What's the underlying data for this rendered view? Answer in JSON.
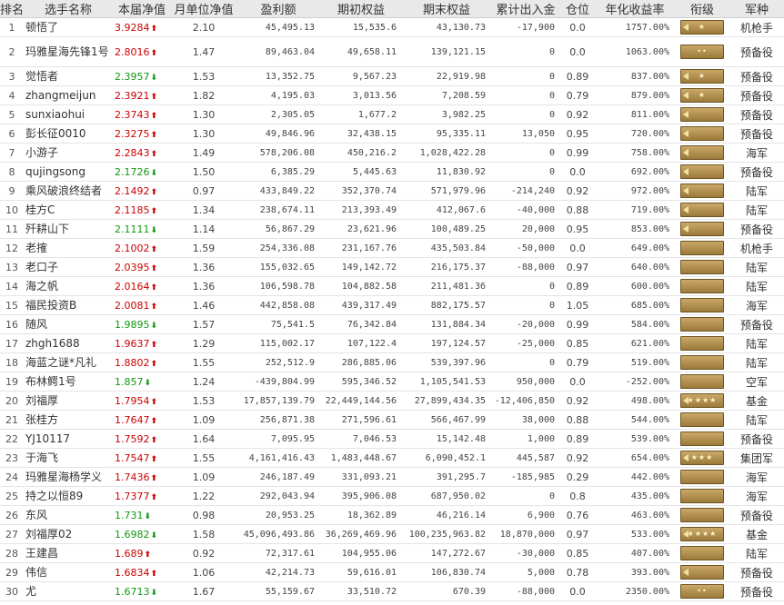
{
  "headers": [
    "排名",
    "选手名称",
    "本届净值",
    "月单位净值",
    "盈利额",
    "期初权益",
    "期末权益",
    "累计出入金",
    "仓位",
    "年化收益率",
    "衔级",
    "军种"
  ],
  "rows": [
    {
      "rank": "1",
      "name": "顿悟了",
      "nav": "3.9284",
      "dir": "up",
      "monthly": "2.10",
      "profit": "45,495.13",
      "start": "15,535.6",
      "end": "43,130.73",
      "flow": "-17,900",
      "pos": "0.0",
      "annual": "1757.00%",
      "stars": "★",
      "ornate": true,
      "corps": "机枪手",
      "tall": false
    },
    {
      "rank": "2",
      "name": "玛雅星海先锋1号",
      "nav": "2.8016",
      "dir": "up",
      "monthly": "1.47",
      "profit": "89,463.04",
      "start": "49,658.11",
      "end": "139,121.15",
      "flow": "0",
      "pos": "0.0",
      "annual": "1063.00%",
      "stars": "••",
      "ornate": false,
      "corps": "预备役",
      "tall": true
    },
    {
      "rank": "3",
      "name": "觉悟者",
      "nav": "2.3957",
      "dir": "down",
      "monthly": "1.53",
      "profit": "13,352.75",
      "start": "9,567.23",
      "end": "22,919.98",
      "flow": "0",
      "pos": "0.89",
      "annual": "837.00%",
      "stars": "★",
      "ornate": true,
      "corps": "预备役",
      "tall": false
    },
    {
      "rank": "4",
      "name": "zhangmeijun",
      "nav": "2.3921",
      "dir": "up",
      "monthly": "1.82",
      "profit": "4,195.03",
      "start": "3,013.56",
      "end": "7,208.59",
      "flow": "0",
      "pos": "0.79",
      "annual": "879.00%",
      "stars": "★",
      "ornate": true,
      "corps": "预备役",
      "tall": false
    },
    {
      "rank": "5",
      "name": "sunxiaohui",
      "nav": "2.3743",
      "dir": "up",
      "monthly": "1.30",
      "profit": "2,305.05",
      "start": "1,677.2",
      "end": "3,982.25",
      "flow": "0",
      "pos": "0.92",
      "annual": "811.00%",
      "stars": "",
      "ornate": true,
      "corps": "预备役",
      "tall": false
    },
    {
      "rank": "6",
      "name": "彭长征0010",
      "nav": "2.3275",
      "dir": "up",
      "monthly": "1.30",
      "profit": "49,846.96",
      "start": "32,438.15",
      "end": "95,335.11",
      "flow": "13,050",
      "pos": "0.95",
      "annual": "720.00%",
      "stars": "",
      "ornate": true,
      "corps": "预备役",
      "tall": false
    },
    {
      "rank": "7",
      "name": "小游子",
      "nav": "2.2843",
      "dir": "up",
      "monthly": "1.49",
      "profit": "578,206.08",
      "start": "450,216.2",
      "end": "1,028,422.28",
      "flow": "0",
      "pos": "0.99",
      "annual": "758.00%",
      "stars": "",
      "ornate": true,
      "corps": "海军",
      "tall": false
    },
    {
      "rank": "8",
      "name": "qujingsong",
      "nav": "2.1726",
      "dir": "down",
      "monthly": "1.50",
      "profit": "6,385.29",
      "start": "5,445.63",
      "end": "11,830.92",
      "flow": "0",
      "pos": "0.0",
      "annual": "692.00%",
      "stars": "",
      "ornate": true,
      "corps": "预备役",
      "tall": false
    },
    {
      "rank": "9",
      "name": "乘风破浪终结者",
      "nav": "2.1492",
      "dir": "up",
      "monthly": "0.97",
      "profit": "433,849.22",
      "start": "352,370.74",
      "end": "571,979.96",
      "flow": "-214,240",
      "pos": "0.92",
      "annual": "972.00%",
      "stars": "",
      "ornate": true,
      "corps": "陆军",
      "tall": false
    },
    {
      "rank": "10",
      "name": "桂方C",
      "nav": "2.1185",
      "dir": "up",
      "monthly": "1.34",
      "profit": "238,674.11",
      "start": "213,393.49",
      "end": "412,067.6",
      "flow": "-40,000",
      "pos": "0.88",
      "annual": "719.00%",
      "stars": "",
      "ornate": true,
      "corps": "陆军",
      "tall": false
    },
    {
      "rank": "11",
      "name": "歼耕山下",
      "nav": "2.1111",
      "dir": "down",
      "monthly": "1.14",
      "profit": "56,867.29",
      "start": "23,621.96",
      "end": "100,489.25",
      "flow": "20,000",
      "pos": "0.95",
      "annual": "853.00%",
      "stars": "",
      "ornate": true,
      "corps": "预备役",
      "tall": false
    },
    {
      "rank": "12",
      "name": "老搉",
      "nav": "2.1002",
      "dir": "up",
      "monthly": "1.59",
      "profit": "254,336.08",
      "start": "231,167.76",
      "end": "435,503.84",
      "flow": "-50,000",
      "pos": "0.0",
      "annual": "649.00%",
      "stars": "",
      "ornate": false,
      "corps": "机枪手",
      "tall": false
    },
    {
      "rank": "13",
      "name": "老口子",
      "nav": "2.0395",
      "dir": "up",
      "monthly": "1.36",
      "profit": "155,032.65",
      "start": "149,142.72",
      "end": "216,175.37",
      "flow": "-88,000",
      "pos": "0.97",
      "annual": "640.00%",
      "stars": "",
      "ornate": false,
      "corps": "陆军",
      "tall": false
    },
    {
      "rank": "14",
      "name": "海之帆",
      "nav": "2.0164",
      "dir": "up",
      "monthly": "1.36",
      "profit": "106,598.78",
      "start": "104,882.58",
      "end": "211,481.36",
      "flow": "0",
      "pos": "0.89",
      "annual": "600.00%",
      "stars": "",
      "ornate": false,
      "corps": "陆军",
      "tall": false
    },
    {
      "rank": "15",
      "name": "福民投资B",
      "nav": "2.0081",
      "dir": "up",
      "monthly": "1.46",
      "profit": "442,858.08",
      "start": "439,317.49",
      "end": "882,175.57",
      "flow": "0",
      "pos": "1.05",
      "annual": "685.00%",
      "stars": "",
      "ornate": false,
      "corps": "海军",
      "tall": false
    },
    {
      "rank": "16",
      "name": "随风",
      "nav": "1.9895",
      "dir": "down",
      "monthly": "1.57",
      "profit": "75,541.5",
      "start": "76,342.84",
      "end": "131,884.34",
      "flow": "-20,000",
      "pos": "0.99",
      "annual": "584.00%",
      "stars": "",
      "ornate": false,
      "corps": "预备役",
      "tall": false
    },
    {
      "rank": "17",
      "name": "zhgh1688",
      "nav": "1.9637",
      "dir": "up",
      "monthly": "1.29",
      "profit": "115,002.17",
      "start": "107,122.4",
      "end": "197,124.57",
      "flow": "-25,000",
      "pos": "0.85",
      "annual": "621.00%",
      "stars": "",
      "ornate": false,
      "corps": "陆军",
      "tall": false
    },
    {
      "rank": "18",
      "name": "海蓝之谜*凡礼",
      "nav": "1.8802",
      "dir": "up",
      "monthly": "1.55",
      "profit": "252,512.9",
      "start": "286,885.06",
      "end": "539,397.96",
      "flow": "0",
      "pos": "0.79",
      "annual": "519.00%",
      "stars": "",
      "ornate": false,
      "corps": "陆军",
      "tall": false
    },
    {
      "rank": "19",
      "name": "布林鳄1号",
      "nav": "1.857",
      "dir": "down",
      "monthly": "1.24",
      "profit": "-439,804.99",
      "start": "595,346.52",
      "end": "1,105,541.53",
      "flow": "950,000",
      "pos": "0.0",
      "annual": "-252.00%",
      "stars": "",
      "ornate": false,
      "corps": "空军",
      "tall": false
    },
    {
      "rank": "20",
      "name": "刘福厚",
      "nav": "1.7954",
      "dir": "up",
      "monthly": "1.53",
      "profit": "17,857,139.79",
      "start": "22,449,144.56",
      "end": "27,899,434.35",
      "flow": "-12,406,850",
      "pos": "0.92",
      "annual": "498.00%",
      "stars": "★★★★",
      "ornate": true,
      "corps": "基金",
      "tall": false
    },
    {
      "rank": "21",
      "name": "张桂方",
      "nav": "1.7647",
      "dir": "up",
      "monthly": "1.09",
      "profit": "256,871.38",
      "start": "271,596.61",
      "end": "566,467.99",
      "flow": "38,000",
      "pos": "0.88",
      "annual": "544.00%",
      "stars": "",
      "ornate": false,
      "corps": "陆军",
      "tall": false
    },
    {
      "rank": "22",
      "name": "YJ10117",
      "nav": "1.7592",
      "dir": "up",
      "monthly": "1.64",
      "profit": "7,095.95",
      "start": "7,046.53",
      "end": "15,142.48",
      "flow": "1,000",
      "pos": "0.89",
      "annual": "539.00%",
      "stars": "",
      "ornate": false,
      "corps": "预备役",
      "tall": false
    },
    {
      "rank": "23",
      "name": "于海飞",
      "nav": "1.7547",
      "dir": "up",
      "monthly": "1.55",
      "profit": "4,161,416.43",
      "start": "1,483,448.67",
      "end": "6,090,452.1",
      "flow": "445,587",
      "pos": "0.92",
      "annual": "654.00%",
      "stars": "★★★",
      "ornate": true,
      "corps": "集团军",
      "tall": false
    },
    {
      "rank": "24",
      "name": "玛雅星海杨学义",
      "nav": "1.7436",
      "dir": "up",
      "monthly": "1.09",
      "profit": "246,187.49",
      "start": "331,093.21",
      "end": "391,295.7",
      "flow": "-185,985",
      "pos": "0.29",
      "annual": "442.00%",
      "stars": "",
      "ornate": false,
      "corps": "海军",
      "tall": false
    },
    {
      "rank": "25",
      "name": "持之以恒89",
      "nav": "1.7377",
      "dir": "up",
      "monthly": "1.22",
      "profit": "292,043.94",
      "start": "395,906.08",
      "end": "687,950.02",
      "flow": "0",
      "pos": "0.8",
      "annual": "435.00%",
      "stars": "",
      "ornate": false,
      "corps": "海军",
      "tall": false
    },
    {
      "rank": "26",
      "name": "东风",
      "nav": "1.731",
      "dir": "down",
      "monthly": "0.98",
      "profit": "20,953.25",
      "start": "18,362.89",
      "end": "46,216.14",
      "flow": "6,900",
      "pos": "0.76",
      "annual": "463.00%",
      "stars": "",
      "ornate": false,
      "corps": "预备役",
      "tall": false
    },
    {
      "rank": "27",
      "name": "刘福厚02",
      "nav": "1.6982",
      "dir": "down",
      "monthly": "1.58",
      "profit": "45,096,493.86",
      "start": "36,269,469.96",
      "end": "100,235,963.82",
      "flow": "18,870,000",
      "pos": "0.97",
      "annual": "533.00%",
      "stars": "★★★★",
      "ornate": true,
      "corps": "基金",
      "tall": false
    },
    {
      "rank": "28",
      "name": "王建昌",
      "nav": "1.689",
      "dir": "up",
      "monthly": "0.92",
      "profit": "72,317.61",
      "start": "104,955.06",
      "end": "147,272.67",
      "flow": "-30,000",
      "pos": "0.85",
      "annual": "407.00%",
      "stars": "",
      "ornate": false,
      "corps": "陆军",
      "tall": false
    },
    {
      "rank": "29",
      "name": "伟信",
      "nav": "1.6834",
      "dir": "up",
      "monthly": "1.06",
      "profit": "42,214.73",
      "start": "59,616.01",
      "end": "106,830.74",
      "flow": "5,000",
      "pos": "0.78",
      "annual": "393.00%",
      "stars": "",
      "ornate": true,
      "corps": "预备役",
      "tall": false
    },
    {
      "rank": "30",
      "name": "尤",
      "nav": "1.6713",
      "dir": "down",
      "monthly": "1.67",
      "profit": "55,159.67",
      "start": "33,510.72",
      "end": "670.39",
      "flow": "-88,000",
      "pos": "0.0",
      "annual": "2350.00%",
      "stars": "••",
      "ornate": false,
      "corps": "预备役",
      "tall": false
    }
  ],
  "colors": {
    "up": "#cc0000",
    "down": "#119911",
    "header_bg": "#e9e9e9",
    "badge": "#b08f4f"
  }
}
